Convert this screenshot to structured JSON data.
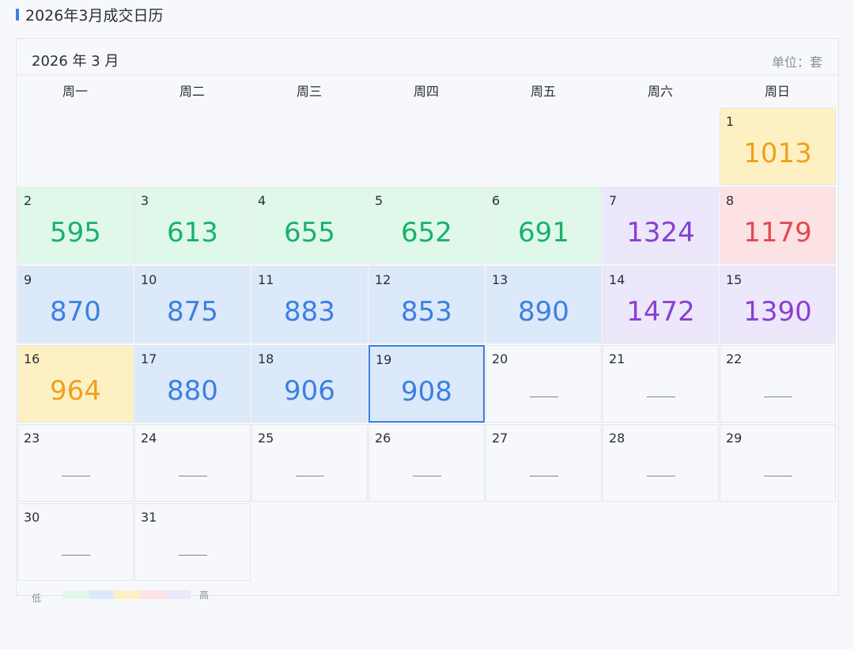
{
  "page": {
    "title": "2026年3月成交日历"
  },
  "calendar": {
    "month_label": "2026 年 3 月",
    "unit_label": "单位：套",
    "weekdays": [
      "周一",
      "周二",
      "周三",
      "周四",
      "周五",
      "周六",
      "周日"
    ],
    "empty_marker": "——",
    "selected_day": 19,
    "days": [
      {
        "day": "1",
        "value": "1013",
        "level": "yellow"
      },
      {
        "day": "2",
        "value": "595",
        "level": "green"
      },
      {
        "day": "3",
        "value": "613",
        "level": "green"
      },
      {
        "day": "4",
        "value": "655",
        "level": "green"
      },
      {
        "day": "5",
        "value": "652",
        "level": "green"
      },
      {
        "day": "6",
        "value": "691",
        "level": "green"
      },
      {
        "day": "7",
        "value": "1324",
        "level": "purple"
      },
      {
        "day": "8",
        "value": "1179",
        "level": "red"
      },
      {
        "day": "9",
        "value": "870",
        "level": "blue"
      },
      {
        "day": "10",
        "value": "875",
        "level": "blue"
      },
      {
        "day": "11",
        "value": "883",
        "level": "blue"
      },
      {
        "day": "12",
        "value": "853",
        "level": "blue"
      },
      {
        "day": "13",
        "value": "890",
        "level": "blue"
      },
      {
        "day": "14",
        "value": "1472",
        "level": "purple"
      },
      {
        "day": "15",
        "value": "1390",
        "level": "purple"
      },
      {
        "day": "16",
        "value": "964",
        "level": "yellow"
      },
      {
        "day": "17",
        "value": "880",
        "level": "blue"
      },
      {
        "day": "18",
        "value": "906",
        "level": "blue"
      },
      {
        "day": "19",
        "value": "908",
        "level": "blue"
      },
      {
        "day": "20",
        "value": null,
        "level": "none"
      },
      {
        "day": "21",
        "value": null,
        "level": "none"
      },
      {
        "day": "22",
        "value": null,
        "level": "none"
      },
      {
        "day": "23",
        "value": null,
        "level": "none"
      },
      {
        "day": "24",
        "value": null,
        "level": "none"
      },
      {
        "day": "25",
        "value": null,
        "level": "none"
      },
      {
        "day": "26",
        "value": null,
        "level": "none"
      },
      {
        "day": "27",
        "value": null,
        "level": "none"
      },
      {
        "day": "28",
        "value": null,
        "level": "none"
      },
      {
        "day": "29",
        "value": null,
        "level": "none"
      },
      {
        "day": "30",
        "value": null,
        "level": "none"
      },
      {
        "day": "31",
        "value": null,
        "level": "none"
      }
    ]
  },
  "legend": {
    "low_label": "低",
    "high_label": "高",
    "colors": [
      "#e0f8e9",
      "#dce9fb",
      "#fdf1c4",
      "#fde2e3",
      "#ece7fb"
    ]
  },
  "colors": {
    "accent": "#3d7fe0",
    "green": "#17b26a",
    "blue": "#3d7fe0",
    "yellow": "#efa11c",
    "purple": "#8a3fd1",
    "red": "#e5484d"
  }
}
